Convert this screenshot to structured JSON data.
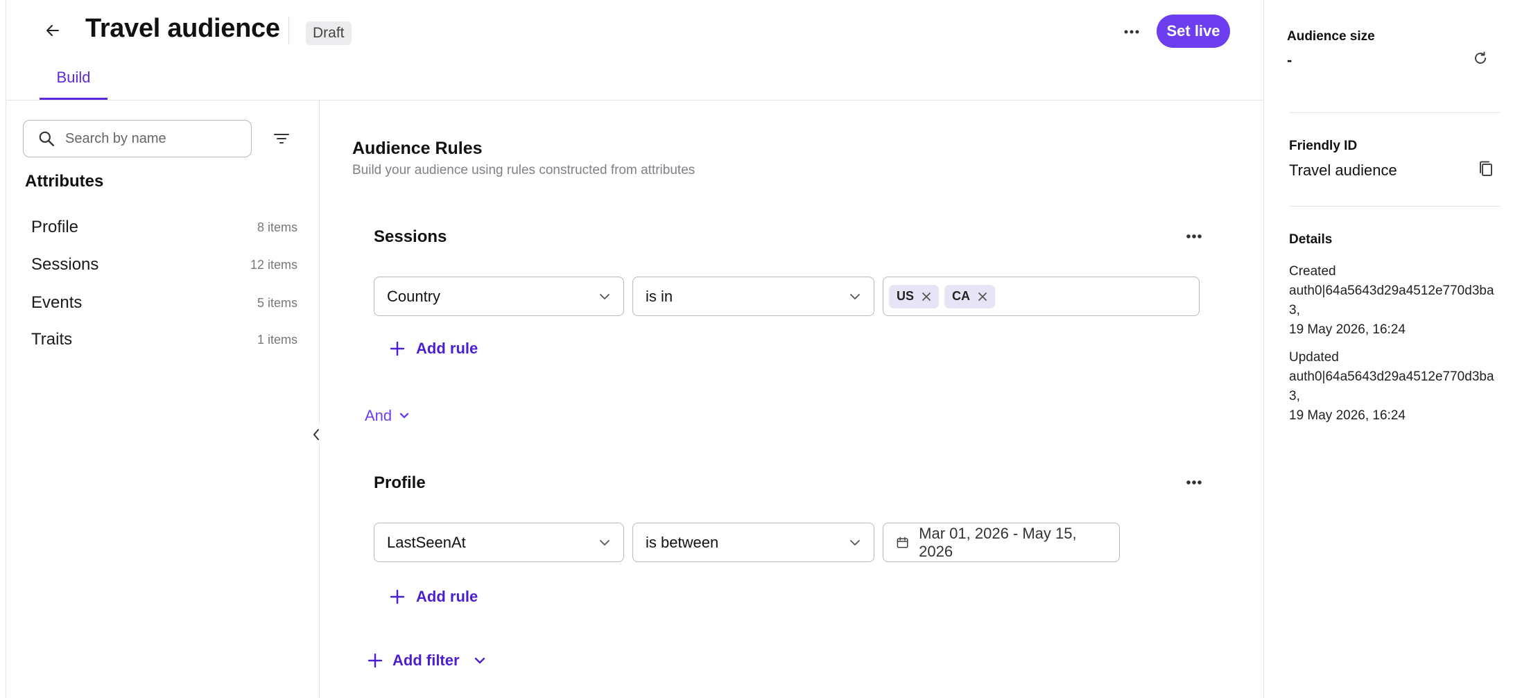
{
  "header": {
    "title": "Travel audience",
    "status_badge": "Draft",
    "set_live_label": "Set live",
    "tabs": [
      {
        "label": "Build",
        "active": true
      }
    ]
  },
  "sidebar": {
    "search_placeholder": "Search by name",
    "heading": "Attributes",
    "items": [
      {
        "label": "Profile",
        "count": "8 items"
      },
      {
        "label": "Sessions",
        "count": "12 items"
      },
      {
        "label": "Events",
        "count": "5 items"
      },
      {
        "label": "Traits",
        "count": "1 items"
      }
    ]
  },
  "main": {
    "title": "Audience Rules",
    "subtitle": "Build your audience using rules constructed from attributes",
    "groups": [
      {
        "title": "Sessions",
        "rule": {
          "attribute": "Country",
          "operator": "is in",
          "values": [
            "US",
            "CA"
          ]
        },
        "add_rule_label": "Add rule"
      },
      {
        "title": "Profile",
        "rule": {
          "attribute": "LastSeenAt",
          "operator": "is between",
          "date_range": "Mar 01, 2026 - May 15, 2026"
        },
        "add_rule_label": "Add rule"
      }
    ],
    "combinator": "And",
    "add_filter_label": "Add filter"
  },
  "details_panel": {
    "audience_size_label": "Audience size",
    "audience_size_value": "-",
    "friendly_id_label": "Friendly ID",
    "friendly_id_value": "Travel audience",
    "details_label": "Details",
    "created_label": "Created",
    "created_by_line1": "auth0|64a5643d29a4512e770d3ba",
    "created_by_line2": "3,",
    "created_at": "19 May 2026, 16:24",
    "updated_label": "Updated",
    "updated_by_line1": "auth0|64a5643d29a4512e770d3ba",
    "updated_by_line2": "3,",
    "updated_at": "19 May 2026, 16:24"
  },
  "colors": {
    "accent": "#6d3ef0",
    "accent_text": "#4a1fd1",
    "chip_bg": "#e8e4f6",
    "border": "#b8b8c0"
  },
  "icons": [
    "arrow-left-icon",
    "more-horizontal-icon",
    "search-icon",
    "filter-icon",
    "chevron-left-icon",
    "chevron-down-icon",
    "close-icon",
    "plus-icon",
    "calendar-icon",
    "refresh-icon",
    "copy-icon"
  ]
}
